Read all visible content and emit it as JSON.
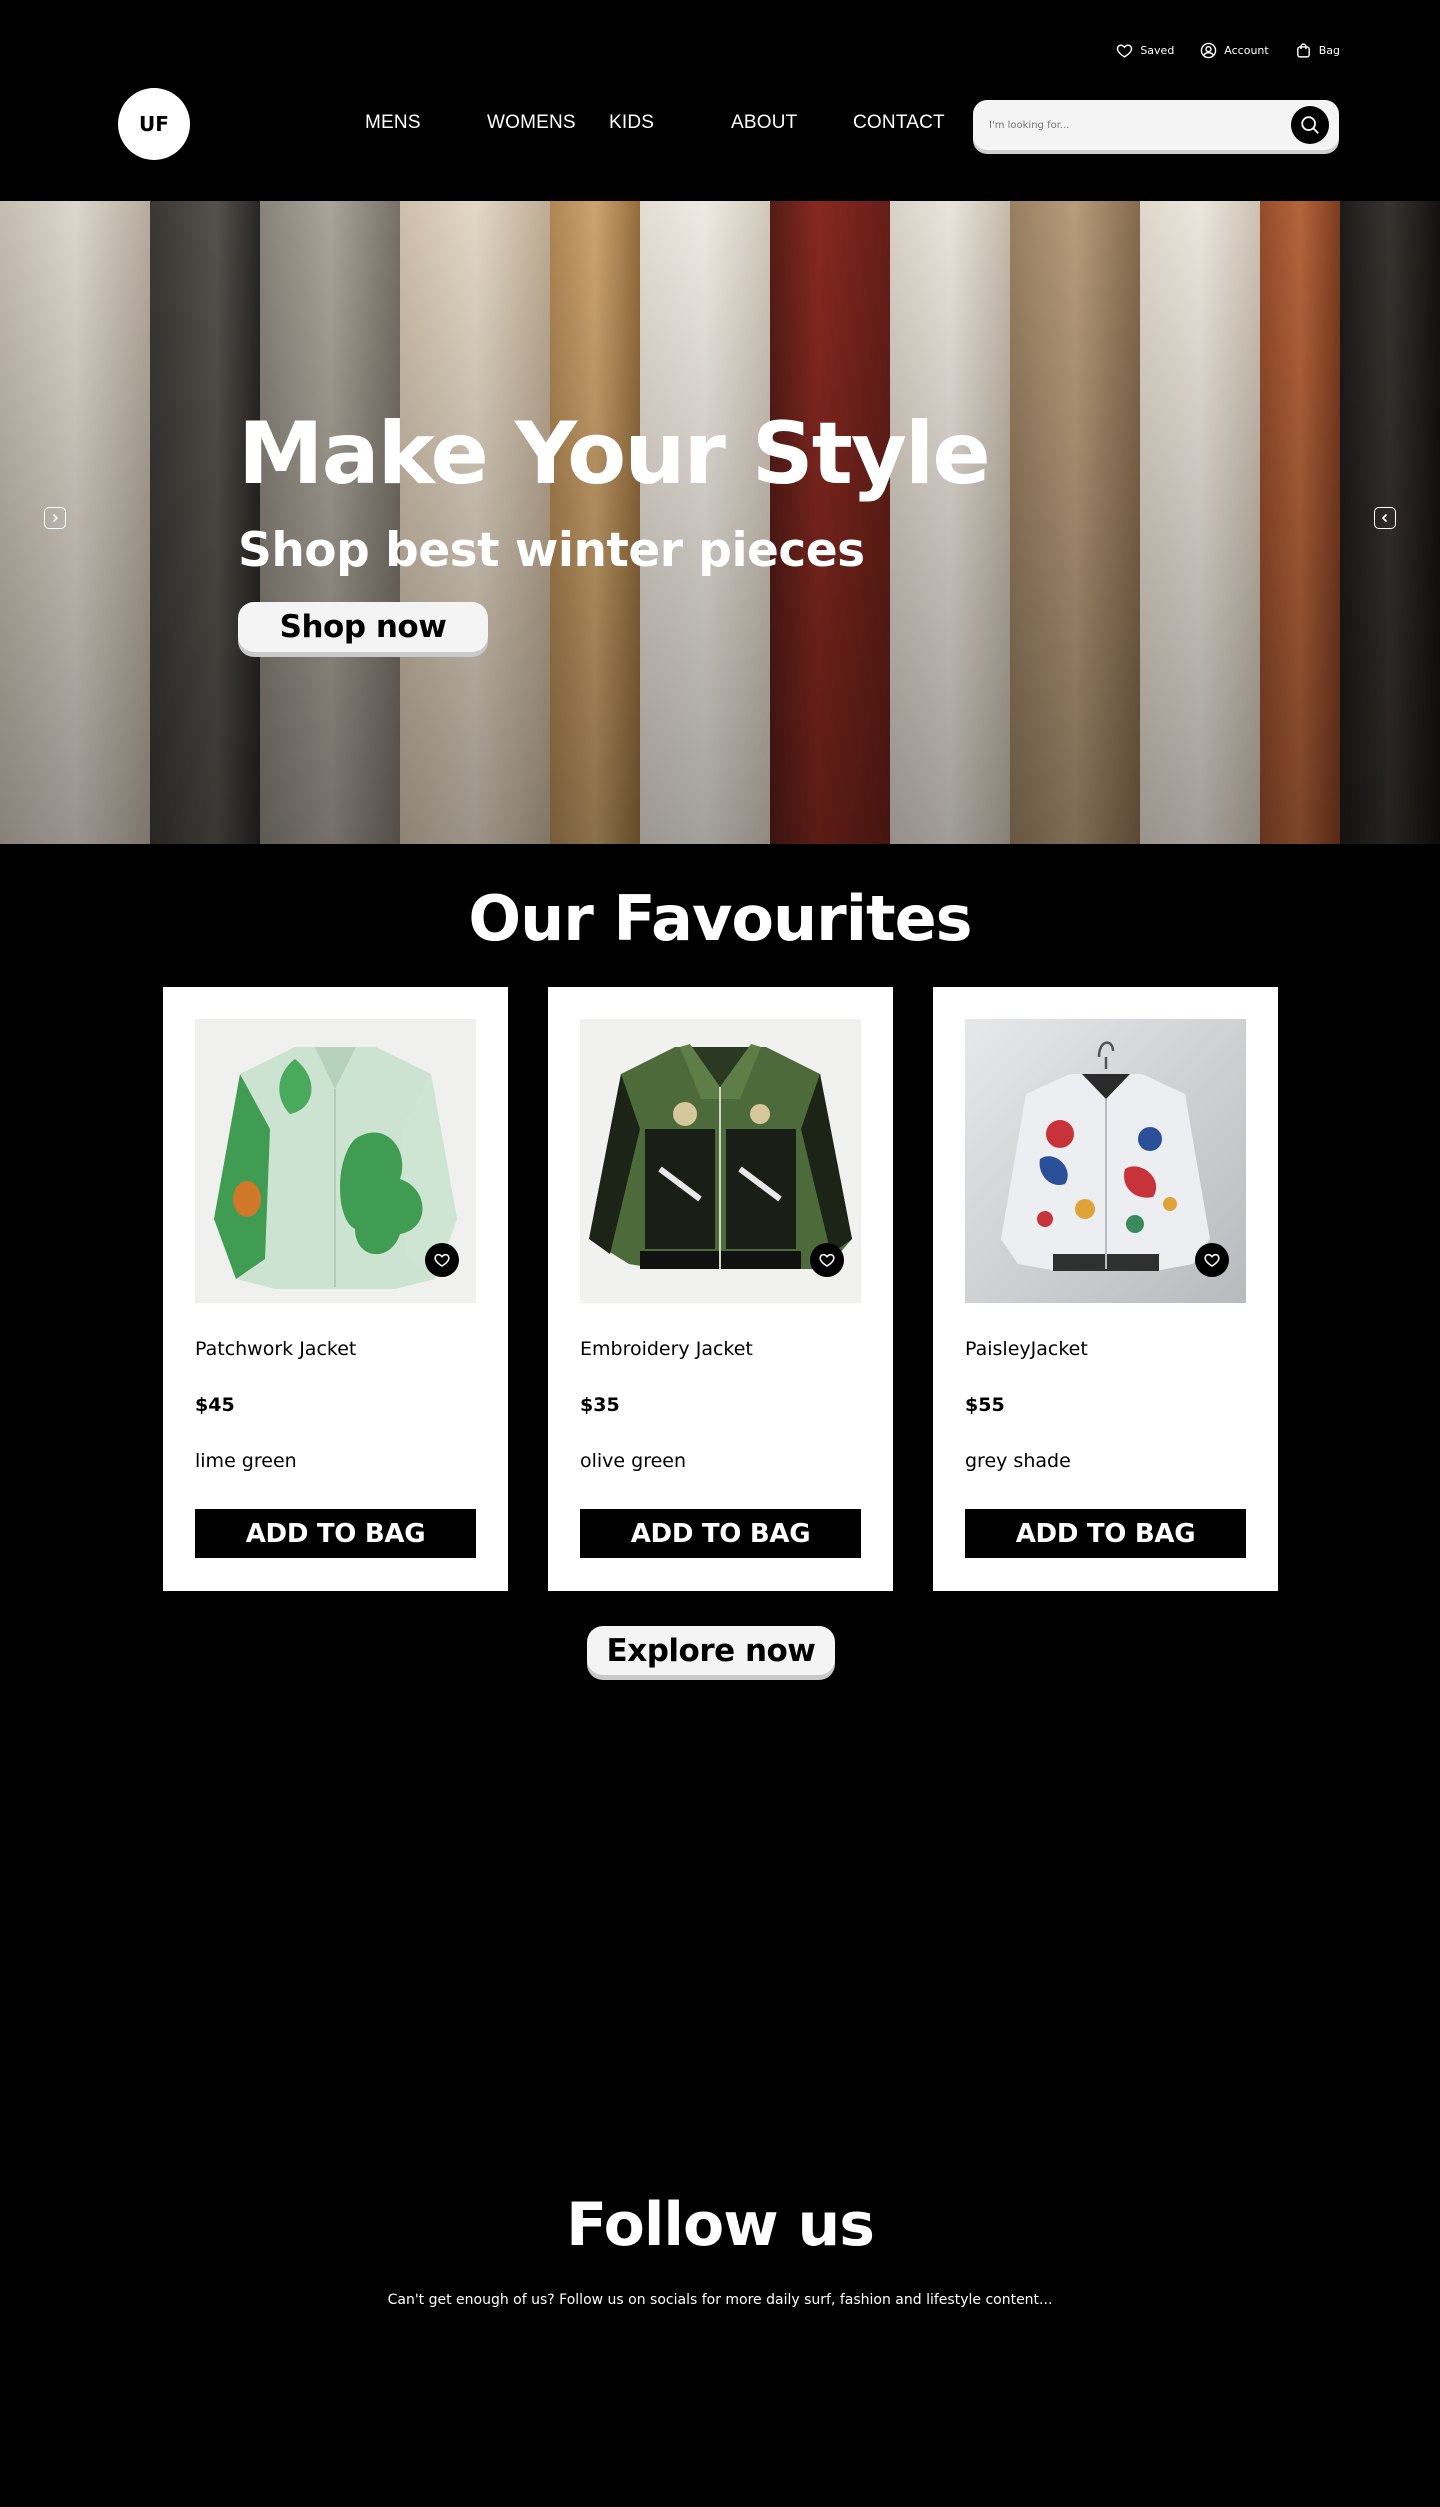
{
  "utility": {
    "saved": "Saved",
    "account": "Account",
    "bag": "Bag"
  },
  "header": {
    "logo": "UF",
    "nav": [
      "MENS",
      "WOMENS",
      "KIDS",
      "ABOUT",
      "CONTACT"
    ],
    "search_placeholder": "I'm looking for..."
  },
  "hero": {
    "title": "Make Your Style",
    "subtitle": "Shop best winter pieces",
    "cta": "Shop now"
  },
  "favourites": {
    "title": "Our Favourites",
    "products": [
      {
        "name": "Patchwork Jacket",
        "price": "$45",
        "color": "lime green",
        "cta": "ADD TO BAG"
      },
      {
        "name": "Embroidery Jacket",
        "price": "$35",
        "color": "olive green",
        "cta": "ADD TO BAG"
      },
      {
        "name": "PaisleyJacket",
        "price": "$55",
        "color": "grey shade",
        "cta": "ADD TO BAG"
      }
    ],
    "explore": "Explore now"
  },
  "follow": {
    "title": "Follow us",
    "text": "Can't get enough of us? Follow us on socials for more daily surf, fashion and lifestyle content..."
  },
  "colors": {
    "background": "#000000",
    "surface": "#ffffff",
    "button_light": "#f4f4f4"
  }
}
